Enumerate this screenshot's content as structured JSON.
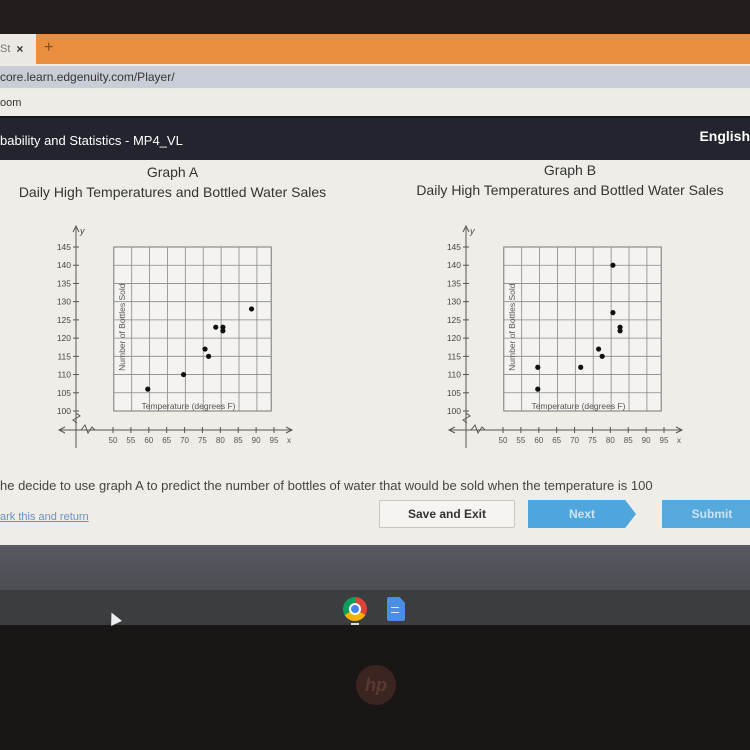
{
  "browser": {
    "tab_title": "St",
    "tab_close": "×",
    "new_tab": "+",
    "url": "core.learn.edgenuity.com/Player/",
    "bookmark": "oom"
  },
  "app": {
    "course_title": "bability and Statistics - MP4_VL",
    "language": "English"
  },
  "question": {
    "text": "he decide to use graph A to predict the number of bottles of water that would be sold when the temperature is 100",
    "mark_link": "ark this and return"
  },
  "buttons": {
    "save_exit": "Save and Exit",
    "next": "Next",
    "submit": "Submit"
  },
  "colors": {
    "header_bg": "#23252e",
    "tabbar": "#e98e3f",
    "button_blue": "#4ea6dc"
  },
  "chart_data": [
    {
      "type": "scatter",
      "name": "Graph A",
      "title": "Graph A",
      "subtitle": "Daily High Temperatures and Bottled Water Sales",
      "xlabel": "Temperature (degrees F)",
      "ylabel": "Number of Bottles Sold",
      "x_axis_letter": "x",
      "y_axis_letter": "y",
      "xlim": [
        50,
        95
      ],
      "ylim": [
        100,
        145
      ],
      "xticks": [
        50,
        55,
        60,
        65,
        70,
        75,
        80,
        85,
        90,
        95
      ],
      "yticks": [
        100,
        105,
        110,
        115,
        120,
        125,
        130,
        135,
        140,
        145
      ],
      "grid": true,
      "points": [
        {
          "x": 60,
          "y": 106
        },
        {
          "x": 70,
          "y": 110
        },
        {
          "x": 76,
          "y": 117
        },
        {
          "x": 77,
          "y": 115
        },
        {
          "x": 79,
          "y": 123
        },
        {
          "x": 81,
          "y": 123
        },
        {
          "x": 81,
          "y": 122
        },
        {
          "x": 89,
          "y": 128
        }
      ]
    },
    {
      "type": "scatter",
      "name": "Graph B",
      "title": "Graph B",
      "subtitle": "Daily High Temperatures and Bottled Water Sales",
      "xlabel": "Temperature (degrees F)",
      "ylabel": "Number of Bottles Sold",
      "x_axis_letter": "x",
      "y_axis_letter": "y",
      "xlim": [
        50,
        95
      ],
      "ylim": [
        100,
        145
      ],
      "xticks": [
        50,
        55,
        60,
        65,
        70,
        75,
        80,
        85,
        90,
        95
      ],
      "yticks": [
        100,
        105,
        110,
        115,
        120,
        125,
        130,
        135,
        140,
        145
      ],
      "grid": true,
      "points": [
        {
          "x": 60,
          "y": 106
        },
        {
          "x": 60,
          "y": 112
        },
        {
          "x": 72,
          "y": 112
        },
        {
          "x": 77,
          "y": 117
        },
        {
          "x": 78,
          "y": 115
        },
        {
          "x": 81,
          "y": 127
        },
        {
          "x": 81,
          "y": 140
        },
        {
          "x": 83,
          "y": 123
        },
        {
          "x": 83,
          "y": 122
        }
      ]
    }
  ]
}
